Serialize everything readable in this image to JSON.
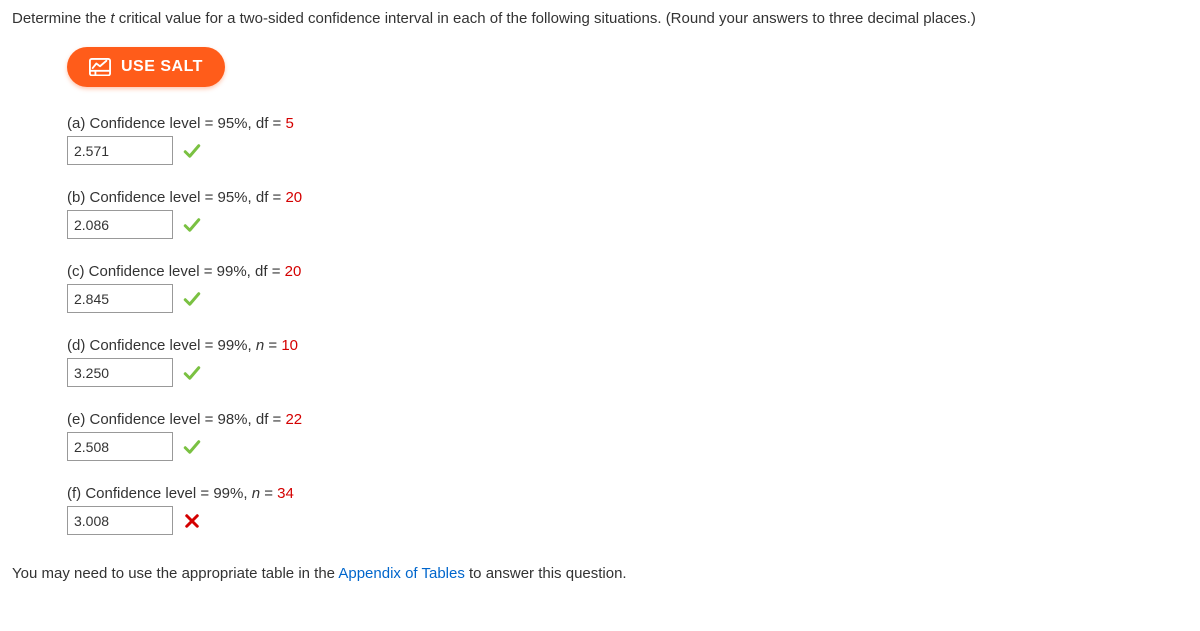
{
  "instructions_prefix": "Determine the ",
  "instructions_italic": "t",
  "instructions_suffix": " critical value for a two-sided confidence interval in each of the following situations. (Round your answers to three decimal places.)",
  "salt_label": "USE SALT",
  "parts": {
    "a": {
      "prefix": "(a) Confidence level = 95%, df = ",
      "num": "5",
      "answer": "2.571",
      "correct": true
    },
    "b": {
      "prefix": "(b) Confidence level = 95%, df = ",
      "num": "20",
      "answer": "2.086",
      "correct": true
    },
    "c": {
      "prefix": "(c) Confidence level = 99%, df = ",
      "num": "20",
      "answer": "2.845",
      "correct": true
    },
    "d": {
      "prefix": "(d) Confidence level = 99%, ",
      "italic_var": "n",
      "eq": " = ",
      "num": "10",
      "answer": "3.250",
      "correct": true
    },
    "e": {
      "prefix": "(e) Confidence level = 98%, df = ",
      "num": "22",
      "answer": "2.508",
      "correct": true
    },
    "f": {
      "prefix": "(f) Confidence level = 99%, ",
      "italic_var": "n",
      "eq": " = ",
      "num": "34",
      "answer": "3.008",
      "correct": false
    }
  },
  "footer_prefix": "You may need to use the appropriate table in the ",
  "footer_link": "Appendix of Tables",
  "footer_suffix": " to answer this question."
}
